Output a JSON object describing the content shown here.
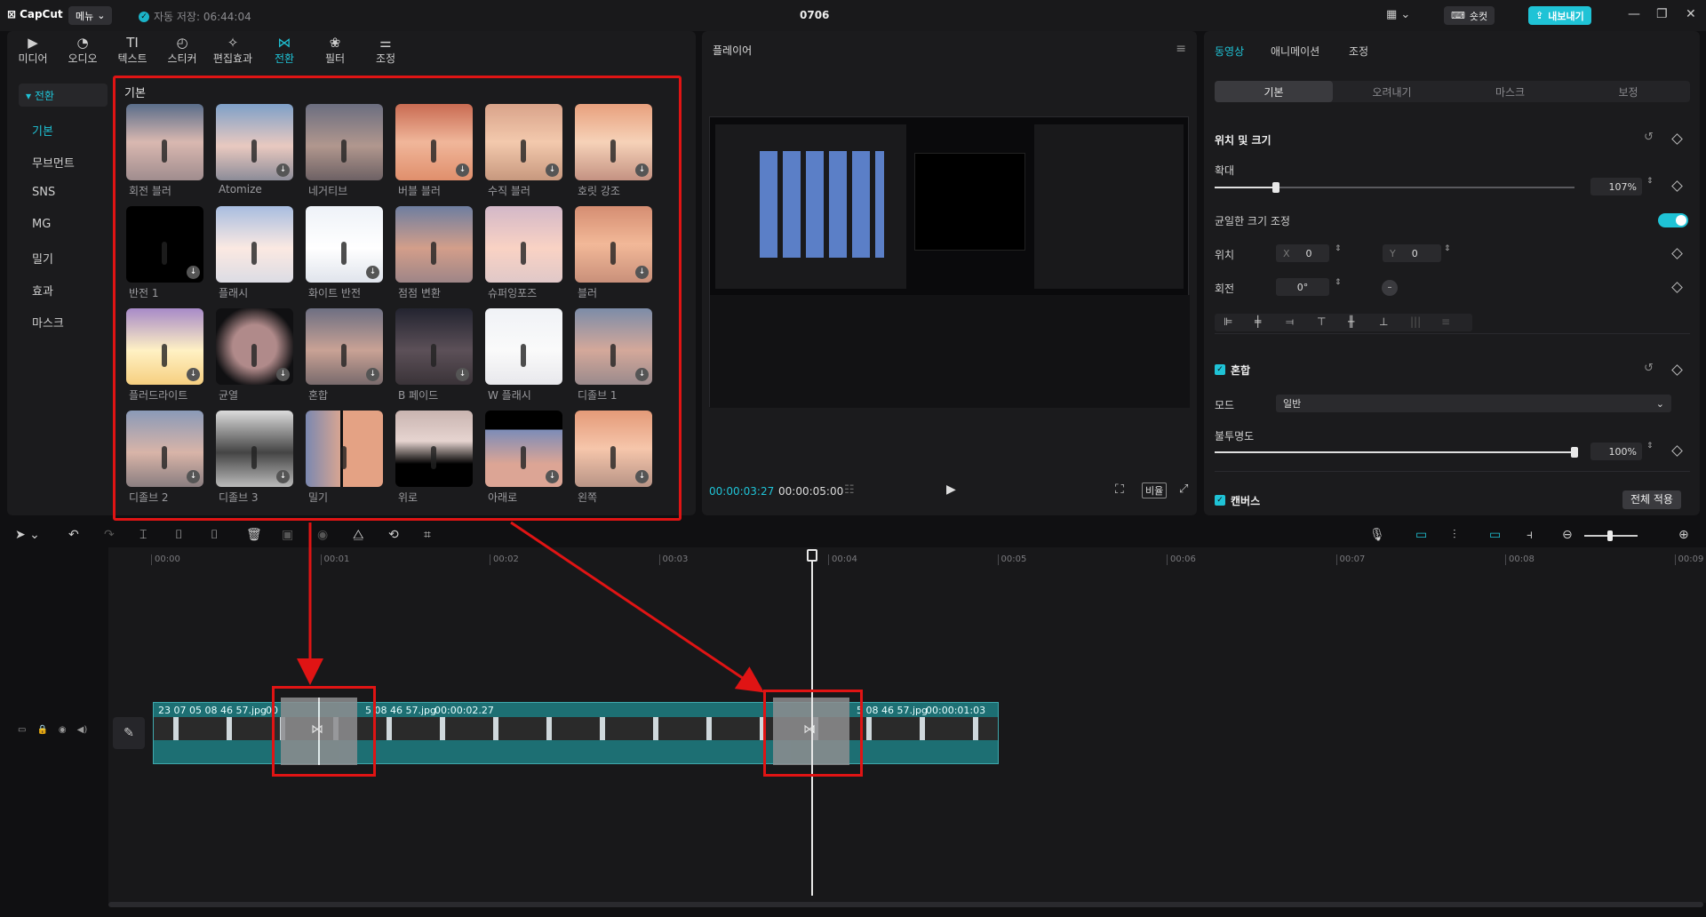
{
  "titlebar": {
    "app_name": "CapCut",
    "menu_label": "메뉴",
    "autosave": "자동 저장: 06:44:04",
    "project_title": "0706",
    "shortcut_label": "숏컷",
    "export_label": "내보내기",
    "accent": "#1fc3d6"
  },
  "media_tabs": [
    {
      "icon": "media-icon",
      "label": "미디어"
    },
    {
      "icon": "audio-icon",
      "label": "오디오"
    },
    {
      "icon": "text-icon",
      "label": "텍스트"
    },
    {
      "icon": "sticker-icon",
      "label": "스티커"
    },
    {
      "icon": "effects-icon",
      "label": "편집효과"
    },
    {
      "icon": "transition-icon",
      "label": "전환"
    },
    {
      "icon": "filter-icon",
      "label": "필터"
    },
    {
      "icon": "adjust-icon",
      "label": "조정"
    }
  ],
  "sidebar": {
    "header": "전환",
    "items": [
      "기본",
      "무브먼트",
      "SNS",
      "MG",
      "밀기",
      "효과",
      "마스크"
    ]
  },
  "section_title": "기본",
  "transitions": [
    "회전 블러",
    "Atomize",
    "네거티브",
    "버블 블러",
    "수직 블러",
    "호릿 강조",
    "반전 1",
    "플래시",
    "화이트 반전",
    "점점 변환",
    "슈퍼잉포즈",
    "블러",
    "플러드라이트",
    "균열",
    "혼합",
    "B 페이드",
    "W 플래시",
    "디졸브 1",
    "디졸브 2",
    "디졸브 3",
    "밀기",
    "위로",
    "아래로",
    "왼쪽"
  ],
  "player": {
    "title": "플레이어",
    "current_time": "00:00:03:27",
    "total_time": "00:00:05:00",
    "ratio_label": "비율"
  },
  "properties": {
    "tabs": [
      "동영상",
      "애니메이션",
      "조정"
    ],
    "subtabs": [
      "기본",
      "오려내기",
      "마스크",
      "보정"
    ],
    "position_size": "위치 및 크기",
    "scale_label": "확대",
    "scale_value": "107%",
    "scale_fraction": 0.17,
    "uniform_scale": "균일한 크기 조정",
    "position_label": "위치",
    "x_label": "X",
    "x_value": "0",
    "y_label": "Y",
    "y_value": "0",
    "rotate_label": "회전",
    "rotate_value": "0°",
    "blend_label": "혼합",
    "mode_label": "모드",
    "mode_value": "일반",
    "opacity_label": "불투명도",
    "opacity_value": "100%",
    "opacity_fraction": 1.0,
    "canvas_label": "캔버스",
    "apply_all": "전체 적용"
  },
  "timeline": {
    "ticks": [
      "00:00",
      "00:01",
      "00:02",
      "00:03",
      "00:04",
      "00:05",
      "00:06",
      "00:07",
      "00:08",
      "00:09"
    ],
    "clips": [
      {
        "name": "23 07 05 08 46 57.jpg",
        "extra": "00"
      },
      {
        "name": "5 08 46 57.jpg",
        "duration": "00:00:02.27"
      },
      {
        "name": "5 08 46 57.jpg",
        "duration": "00:00:01:03"
      }
    ]
  }
}
